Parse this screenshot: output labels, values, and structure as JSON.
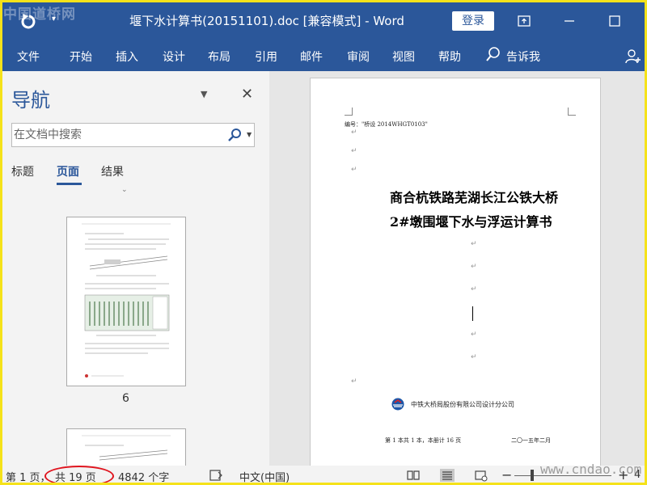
{
  "watermark_top": "中国道桥网",
  "watermark_bottom": "www.cndao.com",
  "title_bar": {
    "document_title": "堰下水计算书(20151101).doc [兼容模式]  -  Word",
    "login_label": "登录"
  },
  "ribbon": {
    "tabs": [
      "文件",
      "开始",
      "插入",
      "设计",
      "布局",
      "引用",
      "邮件",
      "审阅",
      "视图",
      "帮助"
    ],
    "tell_me": "告诉我"
  },
  "navigation": {
    "title": "导航",
    "search_placeholder": "在文档中搜索",
    "tabs": [
      "标题",
      "页面",
      "结果"
    ],
    "active_tab": "页面",
    "thumbnail_page_number": "6"
  },
  "document": {
    "doc_number": "编号：\"桥设 2014WHGT0103\"",
    "title_line1": "商合杭铁路芜湖长江公铁大桥",
    "title_line2": "2#墩围堰下水与浮运计算书",
    "company": "中铁大桥局股份有限公司设计分公司",
    "page_info": "第 1 本共 1 本，本册计 16 页",
    "date": "二〇一五年二月"
  },
  "status_bar": {
    "page": "第 1 页，",
    "total_pages": "共 19 页",
    "word_count": "4842 个字",
    "language": "中文(中国)"
  },
  "colors": {
    "ribbon_blue": "#2b579a",
    "highlight_circle": "#e0141e",
    "frame_yellow": "#f5e21a"
  }
}
